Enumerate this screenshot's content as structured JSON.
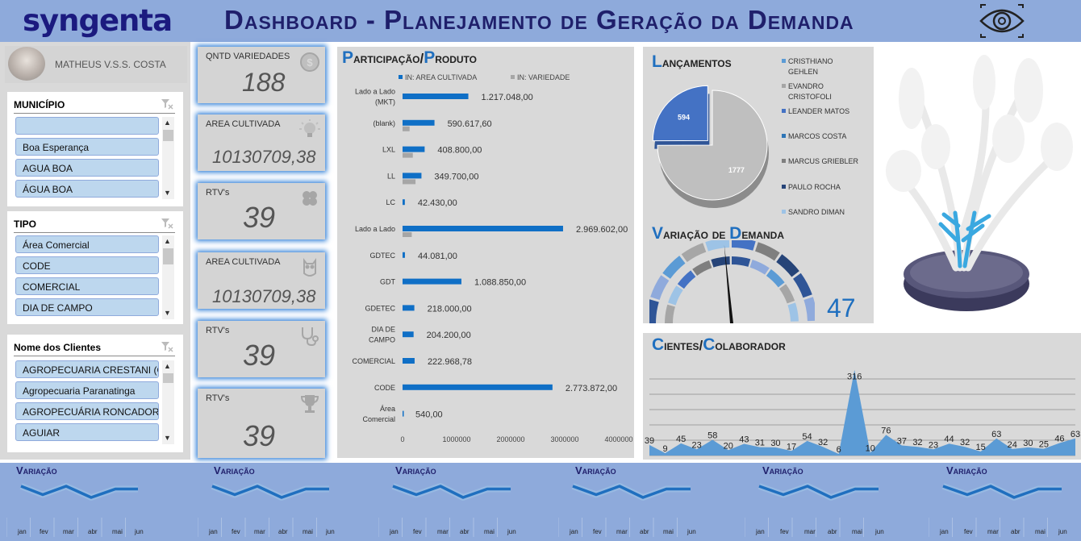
{
  "header": {
    "logo": "syngenta",
    "title": "Dashboard - Planejamento de Geração da Demanda",
    "icon": "eye-icon"
  },
  "user": {
    "name": "MATHEUS V.S.S. COSTA"
  },
  "slicers": {
    "municipio": {
      "title": "MUNICÍPIO",
      "items": [
        "",
        "Boa Esperança",
        "AGUA BOA",
        "ÁGUA BOA"
      ]
    },
    "tipo": {
      "title": "TIPO",
      "items": [
        "Área Comercial",
        "CODE",
        "COMERCIAL",
        "DIA DE CAMPO"
      ]
    },
    "clientes": {
      "title": "Nome dos Clientes",
      "items": [
        "AGROPECUARIA CRESTANI (C...",
        "Agropecuaria Paranatinga",
        "AGROPECUÁRIA RONCADOR",
        "AGUIAR"
      ]
    }
  },
  "kpis": [
    {
      "label": "QNTD VARIEDADES",
      "value": "188",
      "icon": "coin-icon"
    },
    {
      "label": "AREA CULTIVADA",
      "value": "10130709,38",
      "icon": "lightbulb-icon"
    },
    {
      "label": "RTV's",
      "value": "39",
      "icon": "clover-icon"
    },
    {
      "label": "AREA CULTIVADA",
      "value": "10130709,38",
      "icon": "owl-icon"
    },
    {
      "label": "RTV's",
      "value": "39",
      "icon": "stethoscope-icon"
    },
    {
      "label": "RTV's",
      "value": "39",
      "icon": "trophy-icon"
    }
  ],
  "participacao": {
    "title": "Participação/Produto",
    "legend": [
      "IN: AREA CULTIVADA",
      "IN: VARIEDADE"
    ],
    "colors": {
      "area": "#0f6fc6",
      "variedade": "#a6a6a6"
    }
  },
  "lancamentos": {
    "title": "Lançamentos",
    "legend": [
      "CRISTHIANO GEHLEN",
      "EVANDRO CRISTOFOLI",
      "LEANDER MATOS",
      "MARCOS COSTA",
      "MARCUS GRIEBLER",
      "PAULO ROCHA",
      "SANDRO DIMAN"
    ],
    "legend_colors": [
      "#5b9bd5",
      "#a5a5a5",
      "#4472c4",
      "#2e75b6",
      "#7f7f7f",
      "#264478",
      "#9dc3e6"
    ]
  },
  "variacao_demanda": {
    "title": "Variação de Demanda",
    "value": "47"
  },
  "clientes_colaborador": {
    "title": "Cientes/Colaborador"
  },
  "variacao_panels": {
    "title": "Variação",
    "months": [
      "jan",
      "fev",
      "mar",
      "abr",
      "mai",
      "jun"
    ]
  },
  "chart_data": [
    {
      "type": "bar",
      "title": "Participação/Produto",
      "categories": [
        "Lado a Lado (MKT)",
        "(blank)",
        "LXL",
        "LL",
        "LC",
        "Lado a Lado",
        "GDTEC",
        "GDT",
        "GDETEC",
        "DIA DE CAMPO",
        "COMERCIAL",
        "CODE",
        "Área Comercial"
      ],
      "series": [
        {
          "name": "IN: AREA CULTIVADA",
          "values": [
            1217048.0,
            590617.6,
            408800.0,
            349700.0,
            42430.0,
            2969602.0,
            44081.0,
            1088850.0,
            218000.0,
            204200.0,
            222968.78,
            2773872.0,
            540.0
          ]
        },
        {
          "name": "IN: VARIEDADE",
          "values": [
            0,
            130000,
            190000,
            240000,
            0,
            170000,
            0,
            0,
            0,
            0,
            0,
            0,
            0
          ]
        }
      ],
      "data_labels": [
        "1.217.048,00",
        "590.617,60",
        "408.800,00",
        "349.700,00",
        "42.430,00",
        "2.969.602,00",
        "44.081,00",
        "1.088.850,00",
        "218.000,00",
        "204.200,00",
        "222.968,78",
        "2.773.872,00",
        "540,00"
      ],
      "xticks": [
        "0",
        "1000000",
        "2000000",
        "3000000",
        "4000000"
      ],
      "xlim": [
        0,
        4000000
      ]
    },
    {
      "type": "pie",
      "title": "Lançamentos",
      "slices": [
        {
          "label": "594",
          "value": 594
        },
        {
          "label": "1777",
          "value": 1777
        }
      ]
    },
    {
      "type": "area",
      "title": "Cientes/Colaborador",
      "values": [
        39,
        9,
        45,
        23,
        58,
        20,
        43,
        31,
        30,
        17,
        54,
        32,
        6,
        316,
        10,
        76,
        37,
        32,
        23,
        44,
        32,
        15,
        63,
        24,
        30,
        25,
        46,
        63
      ],
      "ylim": [
        0,
        330
      ]
    },
    {
      "type": "line",
      "title": "Variação",
      "categories": [
        "jan",
        "fev",
        "mar",
        "abr",
        "mai",
        "jun"
      ],
      "values": [
        3,
        1.5,
        3,
        1,
        2.5,
        2.5
      ]
    }
  ]
}
